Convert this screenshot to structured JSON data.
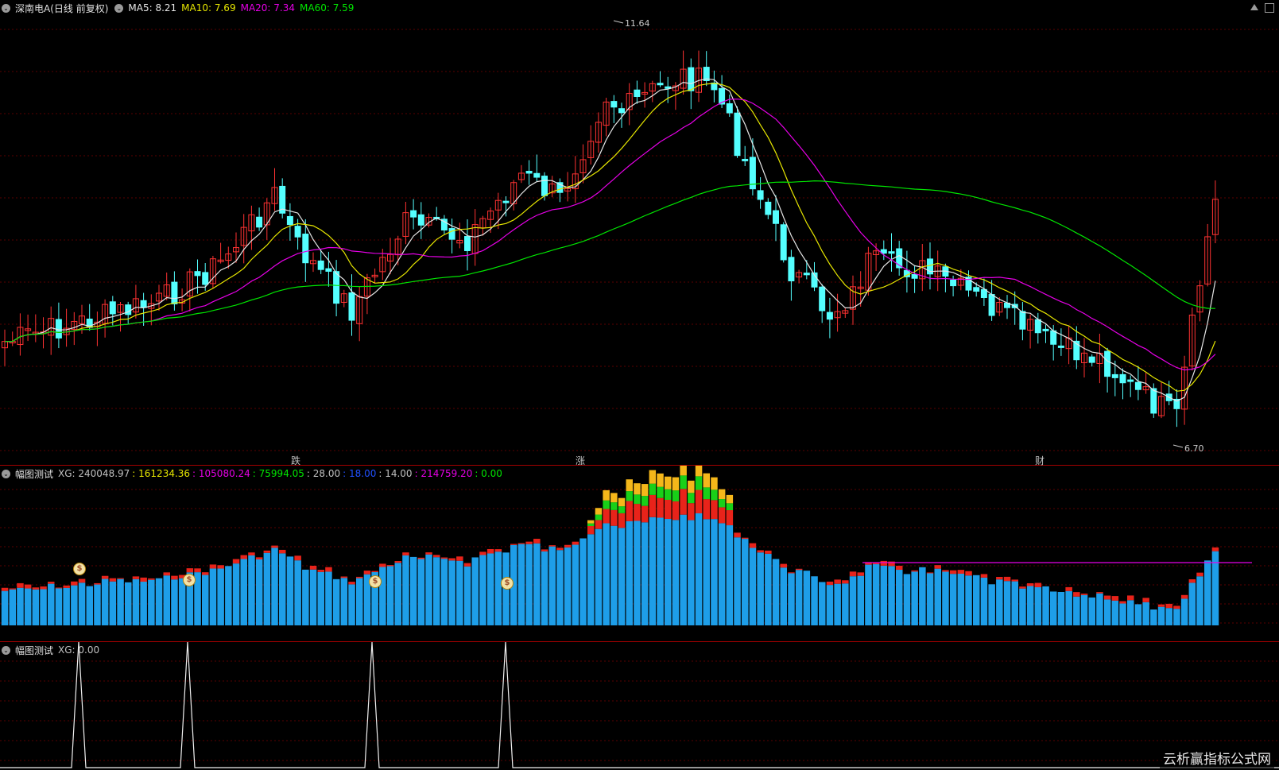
{
  "main": {
    "title": "深南电A(日线 前复权)",
    "ma": [
      {
        "label": "MA5: 8.21",
        "color": "#e6e6e6"
      },
      {
        "label": "MA10: 7.69",
        "color": "#e6e600"
      },
      {
        "label": "MA20: 7.34",
        "color": "#e600e6"
      },
      {
        "label": "MA60: 7.59",
        "color": "#00e600"
      }
    ],
    "high_label": "11.64",
    "low_label": "6.70",
    "markers": [
      {
        "text": "跌",
        "color": "#00cc00"
      },
      {
        "text": "涨",
        "color": "#ff3030"
      },
      {
        "text": "财",
        "color": "#7fb3ff"
      }
    ]
  },
  "panel1": {
    "title": "幅图测试",
    "values": [
      {
        "text": "XG: 240048.97",
        "color": "#c0c0c0"
      },
      {
        "text": ": 161234.36",
        "color": "#e6e600"
      },
      {
        "text": ": 105080.24",
        "color": "#e600e6"
      },
      {
        "text": ": 75994.05",
        "color": "#00e600"
      },
      {
        "text": ": 28.00",
        "color": "#c0c0c0"
      },
      {
        "text": ": 18.00",
        "color": "#2050ff"
      },
      {
        "text": ": 14.00",
        "color": "#c0c0c0"
      },
      {
        "text": ": 214759.20",
        "color": "#e600e6"
      },
      {
        "text": ": 0.00",
        "color": "#00e600"
      }
    ],
    "coin_symbol": "$"
  },
  "panel2": {
    "title": "幅图测试",
    "value": "XG: 0.00"
  },
  "watermark": "云析赢指标公式网",
  "icons": [
    "collapse-circle-icon",
    "scroll-up-icon",
    "maximize-icon",
    "coin-icon"
  ],
  "colors": {
    "up": "#ff3232",
    "down": "#54ffff",
    "separator": "#a30000",
    "bar_base": "#1e9ee8",
    "bar_red": "#e8231a",
    "bar_green": "#18d018",
    "bar_orange": "#f5b71a"
  }
}
